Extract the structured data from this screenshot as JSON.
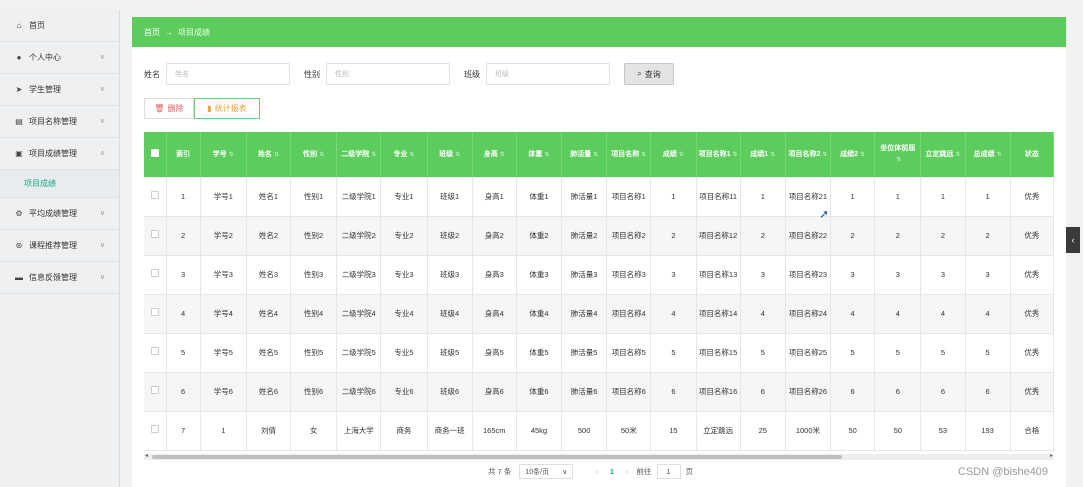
{
  "sidebar": {
    "items": [
      {
        "label": "首页",
        "icon": "home-icon",
        "glyph": "⌂"
      },
      {
        "label": "个人中心",
        "icon": "user-icon",
        "glyph": "👤"
      },
      {
        "label": "学生管理",
        "icon": "send-icon",
        "glyph": "➤"
      },
      {
        "label": "项目名称管理",
        "icon": "file-icon",
        "glyph": "▤"
      },
      {
        "label": "项目成绩管理",
        "icon": "list-icon",
        "glyph": "▣"
      },
      {
        "label": "平均成绩管理",
        "icon": "gear-icon",
        "glyph": "⚙"
      },
      {
        "label": "课程推荐管理",
        "icon": "cog-icon",
        "glyph": "⊛"
      },
      {
        "label": "信息反馈管理",
        "icon": "message-icon",
        "glyph": "▬"
      }
    ],
    "sub_item": "项目成绩"
  },
  "breadcrumb": {
    "home": "首页",
    "sep": "→",
    "current": "项目成绩"
  },
  "search": {
    "name_label": "姓名",
    "name_placeholder": "姓名",
    "gender_label": "性别",
    "gender_placeholder": "性别",
    "class_label": "班级",
    "class_placeholder": "班级",
    "query_label": "查询"
  },
  "actions": {
    "delete_label": "删除",
    "stats_label": "统计报表"
  },
  "table": {
    "headers": [
      "索引",
      "学号",
      "姓名",
      "性别",
      "二级学院",
      "专业",
      "班级",
      "身高",
      "体重",
      "肺活量",
      "项目名称",
      "成绩",
      "项目名称1",
      "成绩1",
      "项目名称2",
      "成绩2",
      "坐位体前屈",
      "立定跳远",
      "总成绩",
      "状态"
    ],
    "rows": [
      [
        "1",
        "学号1",
        "姓名1",
        "性别1",
        "二级学院1",
        "专业1",
        "班级1",
        "身高1",
        "体重1",
        "肺活量1",
        "项目名称1",
        "1",
        "项目名称11",
        "1",
        "项目名称21",
        "1",
        "1",
        "1",
        "1",
        "优秀"
      ],
      [
        "2",
        "学号2",
        "姓名2",
        "性别2",
        "二级学院2",
        "专业2",
        "班级2",
        "身高2",
        "体重2",
        "肺活量2",
        "项目名称2",
        "2",
        "项目名称12",
        "2",
        "项目名称22",
        "2",
        "2",
        "2",
        "2",
        "优秀"
      ],
      [
        "3",
        "学号3",
        "姓名3",
        "性别3",
        "二级学院3",
        "专业3",
        "班级3",
        "身高3",
        "体重3",
        "肺活量3",
        "项目名称3",
        "3",
        "项目名称13",
        "3",
        "项目名称23",
        "3",
        "3",
        "3",
        "3",
        "优秀"
      ],
      [
        "4",
        "学号4",
        "姓名4",
        "性别4",
        "二级学院4",
        "专业4",
        "班级4",
        "身高4",
        "体重4",
        "肺活量4",
        "项目名称4",
        "4",
        "项目名称14",
        "4",
        "项目名称24",
        "4",
        "4",
        "4",
        "4",
        "优秀"
      ],
      [
        "5",
        "学号5",
        "姓名5",
        "性别5",
        "二级学院5",
        "专业5",
        "班级5",
        "身高5",
        "体重5",
        "肺活量5",
        "项目名称5",
        "5",
        "项目名称15",
        "5",
        "项目名称25",
        "5",
        "5",
        "5",
        "5",
        "优秀"
      ],
      [
        "6",
        "学号6",
        "姓名6",
        "性别6",
        "二级学院6",
        "专业6",
        "班级6",
        "身高6",
        "体重6",
        "肺活量6",
        "项目名称6",
        "6",
        "项目名称16",
        "6",
        "项目名称26",
        "6",
        "6",
        "6",
        "6",
        "优秀"
      ],
      [
        "7",
        "1",
        "刘倩",
        "女",
        "上海大学",
        "商务",
        "商务一班",
        "165cm",
        "45kg",
        "500",
        "50米",
        "15",
        "立定跳远",
        "25",
        "1000米",
        "50",
        "50",
        "53",
        "193",
        "合格"
      ]
    ]
  },
  "pager": {
    "total": "共 7 条",
    "page_size": "10条/页",
    "current_page": "1",
    "goto_label": "前往",
    "goto_value": "1",
    "page_suffix": "页"
  },
  "watermark": "CSDN @bishe409"
}
